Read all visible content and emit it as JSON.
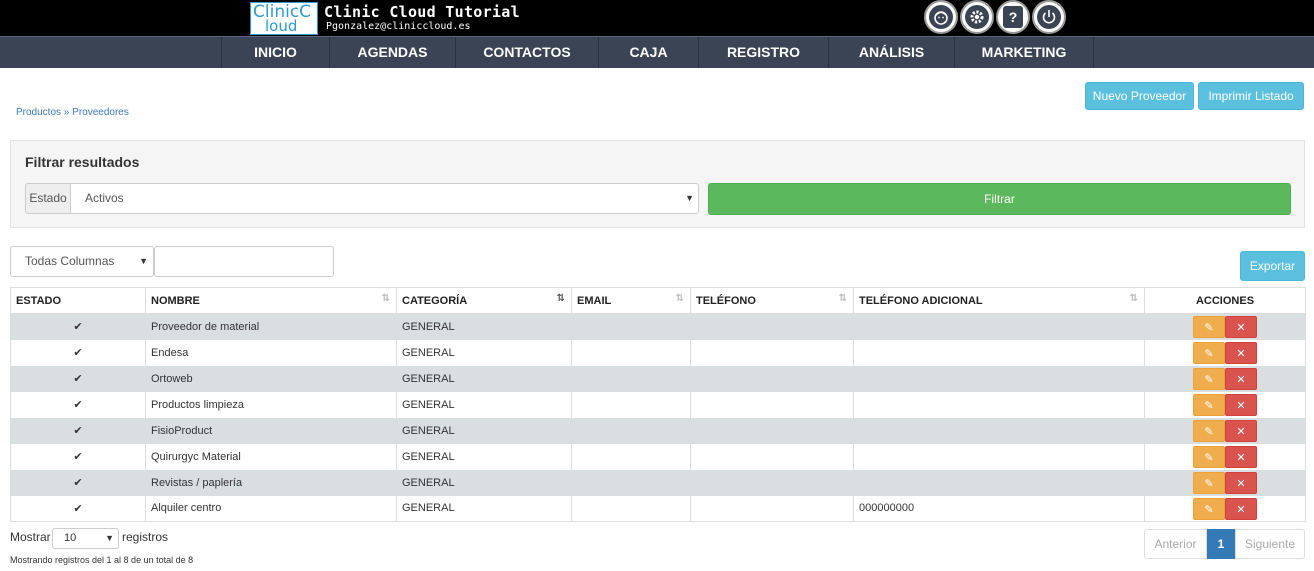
{
  "header": {
    "logo_text": "ClinicCloud",
    "logo_line1": "ClinicC",
    "logo_line2": "loud",
    "title": "Clinic Cloud Tutorial",
    "email": "Pgonzalez@cliniccloud.es",
    "icons": [
      "face-icon",
      "gear-icon",
      "help-icon",
      "power-icon"
    ],
    "icon_glyphs": [
      "☺",
      "⚙",
      "?",
      "⏻"
    ]
  },
  "nav": {
    "items": [
      {
        "label": "INICIO"
      },
      {
        "label": "AGENDAS"
      },
      {
        "label": "CONTACTOS"
      },
      {
        "label": "CAJA"
      },
      {
        "label": "REGISTRO"
      },
      {
        "label": "ANÁLISIS"
      },
      {
        "label": "MARKETING"
      }
    ]
  },
  "toolbar": {
    "new_label": "Nuevo Proveedor",
    "print_label": "Imprimir Listado",
    "export_label": "Exportar"
  },
  "breadcrumb": "Productos » Proveedores",
  "filter": {
    "title": "Filtrar resultados",
    "estado_label": "Estado",
    "estado_value": "Activos",
    "button_label": "Filtrar"
  },
  "search": {
    "column_value": "Todas Columnas",
    "query": ""
  },
  "table": {
    "columns": [
      "ESTADO",
      "NOMBRE",
      "CATEGORÍA",
      "EMAIL",
      "TELÉFONO",
      "TELÉFONO ADICIONAL",
      "ACCIONES"
    ],
    "rows": [
      {
        "estado": "✔",
        "nombre": "Proveedor de material",
        "categoria": "GENERAL",
        "email": "",
        "telefono": "",
        "telefono_adicional": ""
      },
      {
        "estado": "✔",
        "nombre": "Endesa",
        "categoria": "GENERAL",
        "email": "",
        "telefono": "",
        "telefono_adicional": ""
      },
      {
        "estado": "✔",
        "nombre": "Ortoweb",
        "categoria": "GENERAL",
        "email": "",
        "telefono": "",
        "telefono_adicional": ""
      },
      {
        "estado": "✔",
        "nombre": "Productos limpieza",
        "categoria": "GENERAL",
        "email": "",
        "telefono": "",
        "telefono_adicional": ""
      },
      {
        "estado": "✔",
        "nombre": "FisioProduct",
        "categoria": "GENERAL",
        "email": "",
        "telefono": "",
        "telefono_adicional": ""
      },
      {
        "estado": "✔",
        "nombre": "Quirurgyc Material",
        "categoria": "GENERAL",
        "email": "",
        "telefono": "",
        "telefono_adicional": ""
      },
      {
        "estado": "✔",
        "nombre": "Revistas / paplería",
        "categoria": "GENERAL",
        "email": "",
        "telefono": "",
        "telefono_adicional": ""
      },
      {
        "estado": "✔",
        "nombre": "Alquiler centro",
        "categoria": "GENERAL",
        "email": "",
        "telefono": "",
        "telefono_adicional": "000000000"
      }
    ]
  },
  "footer": {
    "show_label": "Mostrar",
    "page_size": "10",
    "records_label": "registros",
    "info": "Mostrando registros del 1 al 8 de un total de 8",
    "prev_label": "Anterior",
    "current_page": "1",
    "next_label": "Siguiente"
  },
  "colors": {
    "nav_bg": "#3a4454",
    "info_button": "#5bc0de",
    "success_button": "#5cb85c",
    "edit_button": "#f0ad4e",
    "delete_button": "#d9534f",
    "active_page": "#337ab7"
  }
}
